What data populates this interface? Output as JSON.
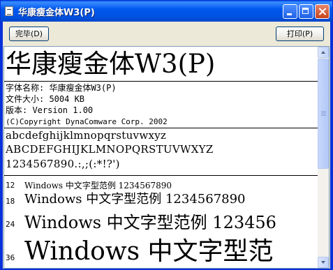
{
  "window": {
    "title": "华康瘦金体W3(P)"
  },
  "toolbar": {
    "done_label": "完毕(D)",
    "print_label": "打印(P)"
  },
  "font": {
    "display_name": "华康瘦金体W3(P)",
    "info": [
      "字体名称: 华康瘦金体W3(P)",
      "文件大小: 5004 KB",
      "版本: Version 1.00",
      "(C)Copyright DynaComware Corp. 2002"
    ],
    "charset": {
      "lowercase": "abcdefghijklmnopqrstuvwxyz",
      "uppercase": "ABCDEFGHIJKLMNOPQRSTUVWXYZ",
      "digits_punct": "1234567890.:,;(:*!?')"
    },
    "samples": [
      {
        "size": "12",
        "text": "Windows 中文字型范例 1234567890"
      },
      {
        "size": "18",
        "text": "Windows 中文字型范例 1234567890"
      },
      {
        "size": "24",
        "text": "Windows 中文字型范例 123456"
      },
      {
        "size": "36",
        "text": "Windows 中文字型范"
      }
    ]
  }
}
